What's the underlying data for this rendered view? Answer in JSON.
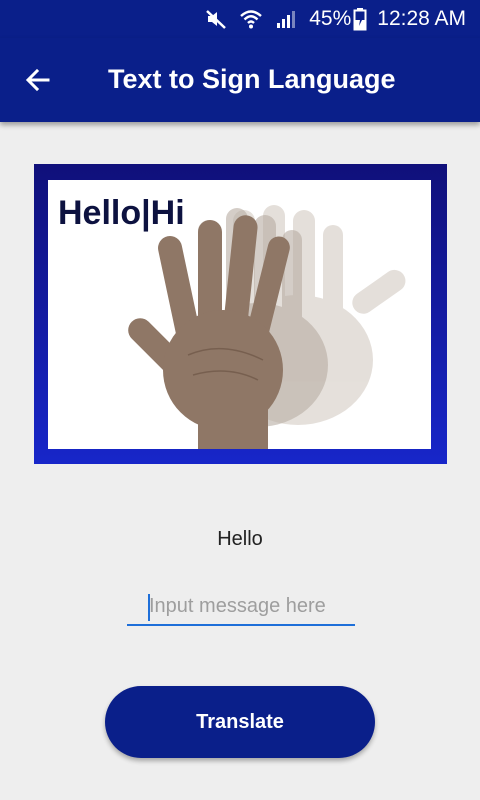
{
  "status_bar": {
    "icons": [
      "mute-icon",
      "wifi-icon",
      "signal-icon",
      "battery-charging-icon"
    ],
    "battery_percent": "45%",
    "time": "12:28 AM"
  },
  "app_bar": {
    "back_icon": "arrow-left-icon",
    "title": "Text to Sign Language"
  },
  "sign_image": {
    "caption": "Hello|Hi",
    "frame_colors": [
      "#10107a",
      "#1726c9"
    ]
  },
  "result": {
    "text": "Hello"
  },
  "message_input": {
    "placeholder": "Input message here",
    "value": ""
  },
  "translate_button": {
    "label": "Translate"
  },
  "colors": {
    "primary": "#0a1f8a",
    "background": "#eeeeee",
    "input_accent": "#1e6fd9"
  }
}
